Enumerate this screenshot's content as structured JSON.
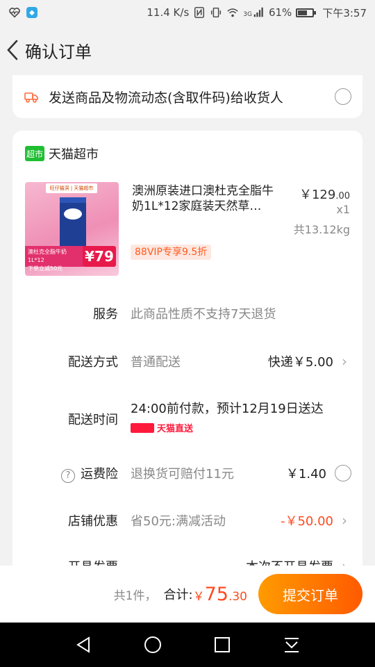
{
  "status_bar": {
    "speed": "11.4 K/s",
    "battery": "61%",
    "battery_level": 0.61,
    "time": "下午3:57",
    "network": "3G"
  },
  "header": {
    "title": "确认订单"
  },
  "notify": {
    "text": "发送商品及物流动态(含取件码)给收货人"
  },
  "shop": {
    "logo_text": "超市",
    "name": "天猫超市"
  },
  "product": {
    "title": "澳洲原装进口澳杜克全脂牛奶1L*12家庭装天然草…",
    "price_currency": "￥",
    "price_int": "129",
    "price_dec": ".00",
    "qty": "x1",
    "weight": "共13.12kg",
    "vip_tag": "88VIP专享9.5折",
    "img_top": "旺仔猫洞 | 天猫超市",
    "img_strip_1": "澳杜克全脂牛奶1L*12",
    "img_strip_2": "下单立减50元",
    "img_price": "¥79"
  },
  "rows": {
    "service": {
      "label": "服务",
      "value": "此商品性质不支持7天退货"
    },
    "delivery_method": {
      "label": "配送方式",
      "value": "普通配送",
      "right": "快递￥5.00"
    },
    "delivery_time": {
      "label": "配送时间",
      "value": "24:00前付款，预计12月19日送达",
      "badge": "天猫直送"
    },
    "insurance": {
      "label": "运费险",
      "value": "退换货可赔付11元",
      "right": "￥1.40"
    },
    "shop_discount": {
      "label": "店铺优惠",
      "value": "省50元:满减活动",
      "right": "-￥50.00"
    },
    "invoice": {
      "label": "开具发票",
      "right": "本次不开具发票"
    }
  },
  "footer": {
    "count": "共1件，",
    "total_label": "合计:",
    "total_currency": "￥",
    "total_int": "75",
    "total_dec": ".30",
    "submit": "提交订单"
  },
  "colors": {
    "accent": "#ff5a00",
    "price_red": "#ff4b1f",
    "tmall_green": "#1fbe32"
  }
}
